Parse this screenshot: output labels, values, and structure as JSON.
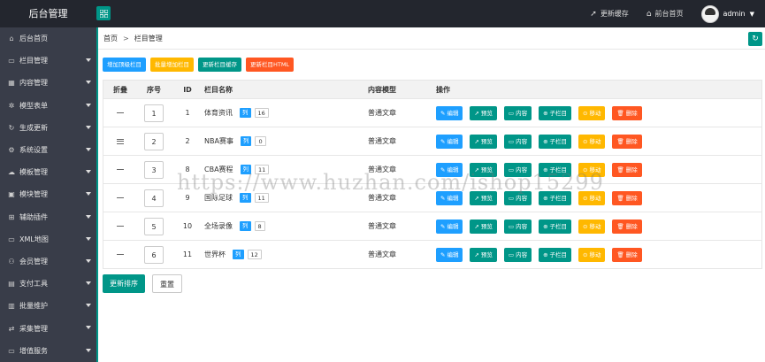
{
  "topbar": {
    "title": "后台管理",
    "update_cache": "更新缓存",
    "front_home": "前台首页",
    "username": "admin"
  },
  "sidebar": {
    "items": [
      {
        "label": "后台首页",
        "icon": "home-icon",
        "glyph": "⌂",
        "has_arrow": false
      },
      {
        "label": "栏目管理",
        "icon": "monitor-icon",
        "glyph": "▭",
        "has_arrow": true
      },
      {
        "label": "内容管理",
        "icon": "grid-icon",
        "glyph": "▦",
        "has_arrow": true
      },
      {
        "label": "模型表单",
        "icon": "settings-icon",
        "glyph": "✲",
        "has_arrow": true
      },
      {
        "label": "生成更新",
        "icon": "refresh-icon",
        "glyph": "↻",
        "has_arrow": true
      },
      {
        "label": "系统设置",
        "icon": "gear-icon",
        "glyph": "⚙",
        "has_arrow": true
      },
      {
        "label": "模板管理",
        "icon": "template-icon",
        "glyph": "☁",
        "has_arrow": true
      },
      {
        "label": "模块管理",
        "icon": "module-icon",
        "glyph": "▣",
        "has_arrow": true
      },
      {
        "label": "辅助插件",
        "icon": "plugin-icon",
        "glyph": "⊞",
        "has_arrow": true
      },
      {
        "label": "XML地图",
        "icon": "map-icon",
        "glyph": "▭",
        "has_arrow": true
      },
      {
        "label": "会员管理",
        "icon": "user-icon",
        "glyph": "⚇",
        "has_arrow": true
      },
      {
        "label": "支付工具",
        "icon": "pay-icon",
        "glyph": "▤",
        "has_arrow": true
      },
      {
        "label": "批量维护",
        "icon": "batch-icon",
        "glyph": "▥",
        "has_arrow": true
      },
      {
        "label": "采集管理",
        "icon": "collect-icon",
        "glyph": "⇄",
        "has_arrow": true
      },
      {
        "label": "增值服务",
        "icon": "service-icon",
        "glyph": "▭",
        "has_arrow": true
      }
    ]
  },
  "breadcrumb": {
    "home": "首页",
    "sep": ">",
    "current": "栏目管理"
  },
  "toolbar": {
    "add_top": "增加顶级栏目",
    "batch_add": "批量增加栏目",
    "update_cache": "更新栏目缓存",
    "update_html": "更新栏目HTML"
  },
  "table": {
    "headers": {
      "fold": "折叠",
      "order": "序号",
      "id": "ID",
      "name": "栏目名称",
      "model": "内容模型",
      "ops": "操作"
    },
    "list_label": "列",
    "actions": {
      "edit": "编辑",
      "preview": "预览",
      "content": "内容",
      "child": "子栏目",
      "move": "移动",
      "delete": "删除"
    },
    "rows": [
      {
        "fold": "dash",
        "order": "1",
        "id": "1",
        "name": "体育资讯",
        "count": "16",
        "model": "普通文章"
      },
      {
        "fold": "menu",
        "order": "2",
        "id": "2",
        "name": "NBA赛事",
        "count": "0",
        "model": "普通文章"
      },
      {
        "fold": "dash",
        "order": "3",
        "id": "8",
        "name": "CBA赛程",
        "count": "11",
        "model": "普通文章"
      },
      {
        "fold": "dash",
        "order": "4",
        "id": "9",
        "name": "国际足球",
        "count": "11",
        "model": "普通文章"
      },
      {
        "fold": "dash",
        "order": "5",
        "id": "10",
        "name": "全场录像",
        "count": "8",
        "model": "普通文章"
      },
      {
        "fold": "dash",
        "order": "6",
        "id": "11",
        "name": "世界杯",
        "count": "12",
        "model": "普通文章"
      }
    ]
  },
  "bottom": {
    "update_sort": "更新排序",
    "reset": "重置"
  },
  "watermark": "https://www.huzhan.com/ishop15299",
  "colors": {
    "primary": "#009688",
    "blue": "#1e9fff",
    "yellow": "#ffb800",
    "red": "#ff5722",
    "topbar": "#23262e",
    "sidebar": "#393d49"
  }
}
